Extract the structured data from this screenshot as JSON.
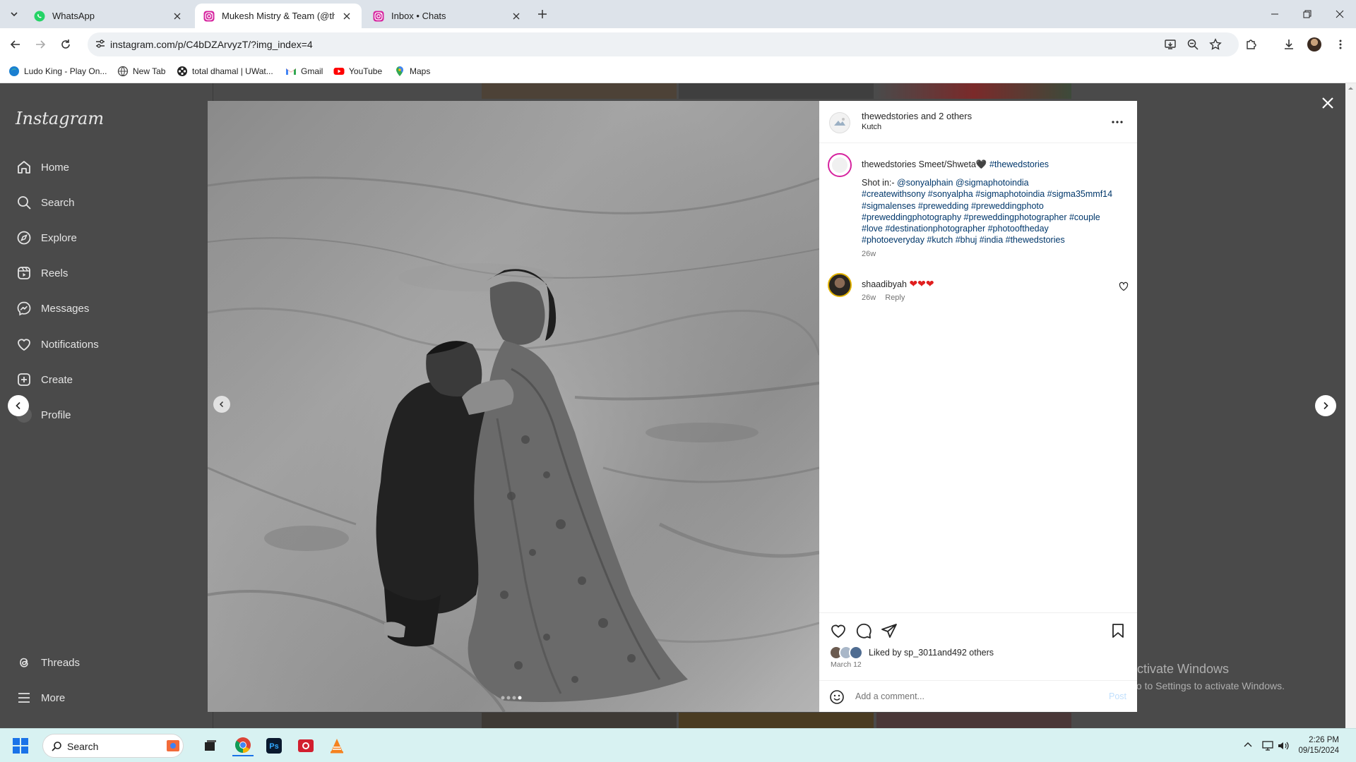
{
  "browser": {
    "tabs": [
      {
        "title": "WhatsApp",
        "active": false
      },
      {
        "title": "Mukesh Mistry & Team (@thew",
        "active": true
      },
      {
        "title": "Inbox • Chats",
        "active": false
      }
    ],
    "url": "instagram.com/p/C4bDZArvyzT/?img_index=4",
    "bookmarks": [
      {
        "label": "Ludo King - Play On..."
      },
      {
        "label": "New Tab"
      },
      {
        "label": "total dhamal | UWat..."
      },
      {
        "label": "Gmail"
      },
      {
        "label": "YouTube"
      },
      {
        "label": "Maps"
      }
    ]
  },
  "sidebar": {
    "logo": "Instagram",
    "items": [
      {
        "label": "Home",
        "icon": "home-icon"
      },
      {
        "label": "Search",
        "icon": "search-icon"
      },
      {
        "label": "Explore",
        "icon": "compass-icon"
      },
      {
        "label": "Reels",
        "icon": "reels-icon"
      },
      {
        "label": "Messages",
        "icon": "messenger-icon"
      },
      {
        "label": "Notifications",
        "icon": "heart-icon"
      },
      {
        "label": "Create",
        "icon": "plus-square-icon"
      },
      {
        "label": "Profile",
        "icon": "avatar"
      },
      {
        "label": "Threads",
        "icon": "threads-icon"
      },
      {
        "label": "More",
        "icon": "menu-icon"
      }
    ]
  },
  "post": {
    "header": {
      "username": "thewedstories",
      "collab_suffix": " and ",
      "collab_others": "2 others",
      "location": "Kutch"
    },
    "caption": {
      "username": "thewedstories",
      "text": "Smeet/Shweta🖤",
      "hashtag_inline": "#thewedstories",
      "shot_in_label": "Shot in:- ",
      "mentions": "@sonyalphain @sigmaphotoindia",
      "hashtag_lines": [
        "#createwithsony #sonyalpha #sigmaphotoindia #sigma35mmf14",
        "#sigmalenses #prewedding #preweddingphoto",
        "#preweddingphotography #preweddingphotographer #couple",
        "#love #destinationphotographer #photooftheday",
        "#photoeveryday #kutch #bhuj #india #thewedstories"
      ],
      "time": "26w"
    },
    "comments": [
      {
        "username": "shaadibyah",
        "text": "❤❤❤",
        "time": "26w",
        "reply": "Reply"
      }
    ],
    "likes": {
      "prefix": "Liked by ",
      "user": "sp_3011",
      "middle": " and ",
      "others": "492 others"
    },
    "date": "March 12",
    "comment_placeholder": "Add a comment...",
    "post_button": "Post",
    "carousel": {
      "count": 4,
      "current": 4
    }
  },
  "watermark": {
    "line1": "Activate Windows",
    "line2": "Go to Settings to activate Windows."
  },
  "taskbar": {
    "search": "Search",
    "time": "2:26 PM",
    "date": "09/15/2024"
  }
}
